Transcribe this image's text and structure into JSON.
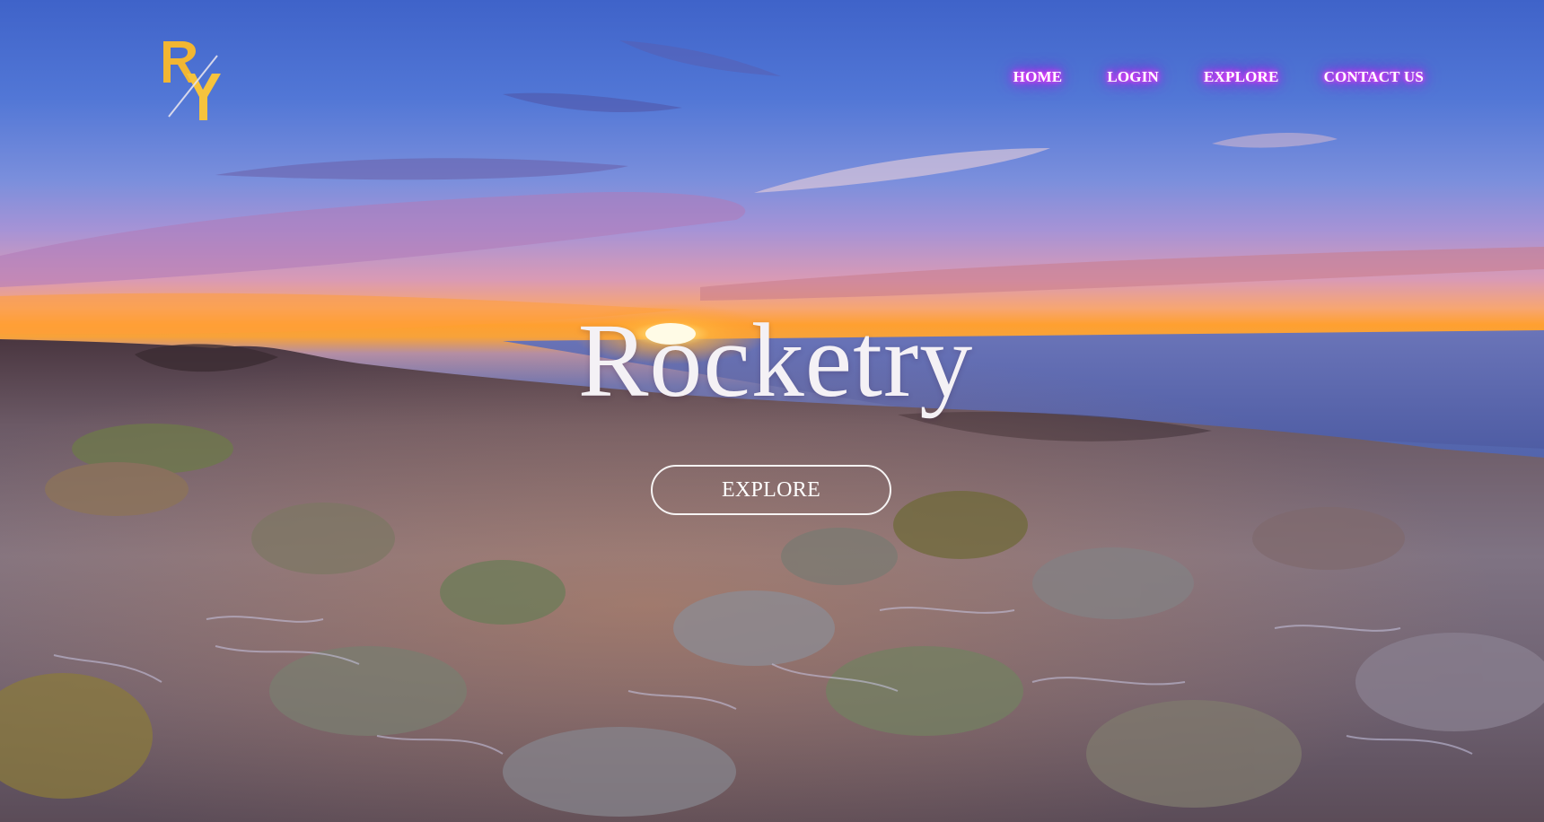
{
  "nav": {
    "items": [
      {
        "label": "HOME"
      },
      {
        "label": "LOGIN"
      },
      {
        "label": "EXPLORE"
      },
      {
        "label": "CONTACT US"
      }
    ]
  },
  "logo": {
    "letters": "RY"
  },
  "hero": {
    "title": "Rocketry",
    "button_label": "EXPLORE"
  },
  "colors": {
    "nav_glow": "#ff3cff",
    "logo_gold": "#f2b632",
    "title_text": "#f4f1f5"
  }
}
